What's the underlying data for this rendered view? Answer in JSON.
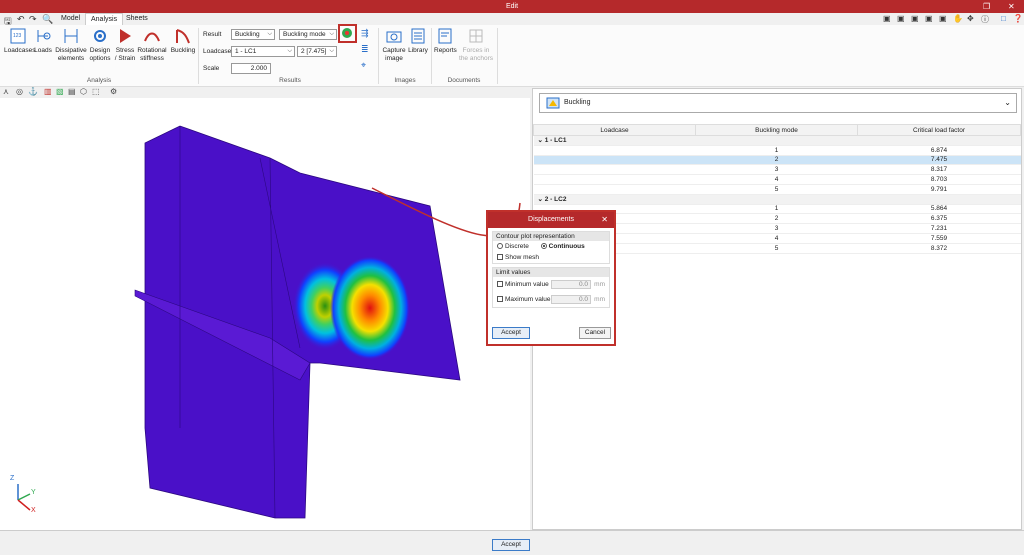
{
  "window": {
    "title": "Edit"
  },
  "tabs": [
    "Model",
    "Analysis",
    "Sheets"
  ],
  "ribbon": {
    "analysis_buttons": [
      "Loadcases",
      "Loads",
      "Dissipative elements",
      "Design options",
      "Stress / Strain",
      "Rotational stiffness",
      "Buckling"
    ],
    "analysis_group": "Analysis",
    "results_group": "Results",
    "result_label": "Result",
    "result_value": "Buckling",
    "result_sub_value": "Buckling mode",
    "loadcase_label": "Loadcase",
    "loadcase_value": "1 - LC1",
    "mode_value": "2 [7.475]",
    "scale_label": "Scale",
    "scale_value": "2.000",
    "images_buttons": [
      "Capture image",
      "Library"
    ],
    "images_group": "Images",
    "documents_buttons": [
      "Reports",
      "Forces in the anchors"
    ],
    "documents_group": "Documents"
  },
  "panel": {
    "combo_value": "Buckling",
    "table_headers": [
      "Loadcase",
      "Buckling mode",
      "Critical load factor"
    ],
    "groups": [
      {
        "name": "1 - LC1",
        "rows": [
          [
            "1",
            "6.874"
          ],
          [
            "2",
            "7.475"
          ],
          [
            "3",
            "8.317"
          ],
          [
            "4",
            "8.703"
          ],
          [
            "5",
            "9.791"
          ]
        ]
      },
      {
        "name": "2 - LC2",
        "rows": [
          [
            "1",
            "5.864"
          ],
          [
            "2",
            "6.375"
          ],
          [
            "3",
            "7.231"
          ],
          [
            "4",
            "7.559"
          ],
          [
            "5",
            "8.372"
          ]
        ]
      }
    ]
  },
  "dialog": {
    "title": "Displacements",
    "section1": "Contour plot representation",
    "discrete": "Discrete",
    "continuous": "Continuous",
    "show_mesh": "Show mesh",
    "section2": "Limit values",
    "min_label": "Minimum value",
    "max_label": "Maximum value",
    "min_value": "0.0",
    "max_value": "0.0",
    "unit": "mm",
    "accept": "Accept",
    "cancel": "Cancel"
  },
  "axes": {
    "z": "Z",
    "y": "Y",
    "x": "X"
  },
  "bottom": {
    "accept": "Accept"
  }
}
